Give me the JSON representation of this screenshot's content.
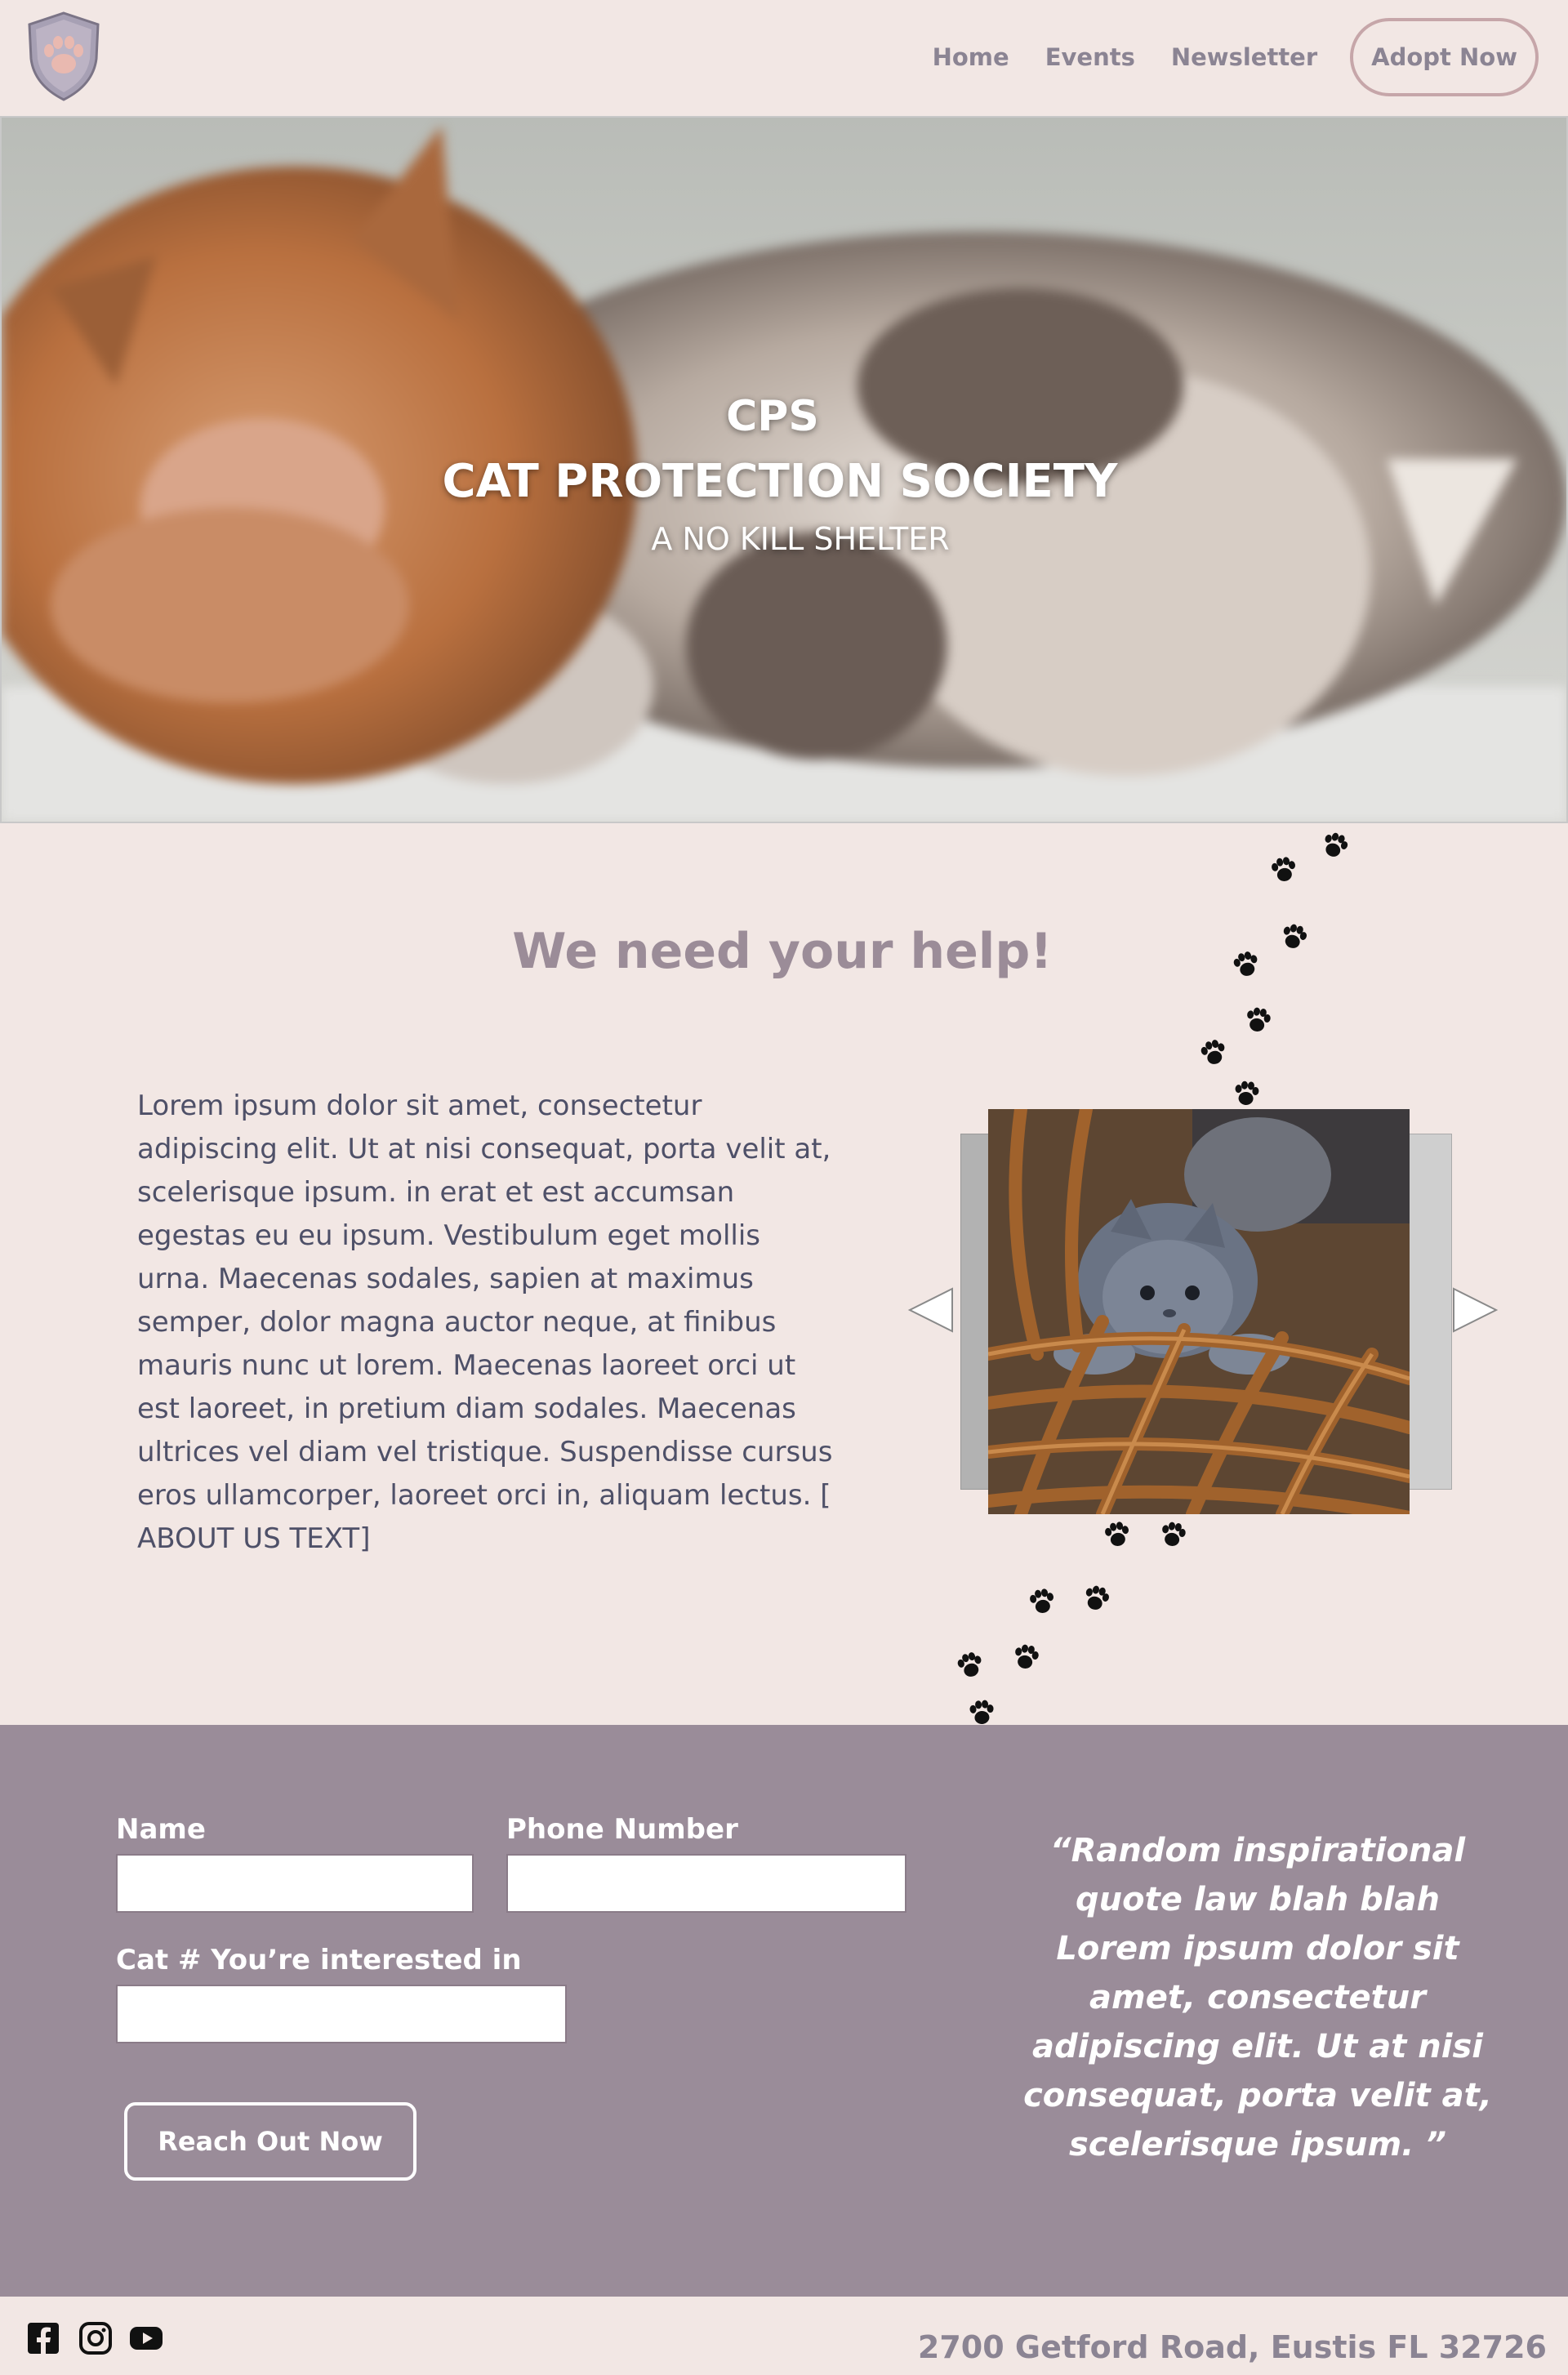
{
  "header": {
    "logo_alt": "paw shield logo",
    "nav": [
      {
        "label": "Home"
      },
      {
        "label": "Events"
      },
      {
        "label": "Newsletter"
      }
    ],
    "cta_label": "Adopt Now"
  },
  "hero": {
    "abbr": "CPS",
    "title": "CAT PROTECTION SOCIETY",
    "subtitle": "A NO KILL SHELTER"
  },
  "help": {
    "title": "We need your help!",
    "body": "Lorem ipsum dolor sit amet, consectetur adipiscing elit. Ut at nisi consequat, porta velit at, scelerisque ipsum. in erat et est accumsan egestas eu eu ipsum. Vestibulum eget mollis urna. Maecenas sodales, sapien at maximus semper, dolor magna auctor neque, at finibus mauris nunc ut lorem. Maecenas laoreet orci ut est laoreet, in pretium diam sodales. Maecenas ultrices vel diam vel tristique. Suspendisse cursus eros ullamcorper, laoreet orci in, aliquam lectus. [ ABOUT US TEXT]"
  },
  "form": {
    "name_label": "Name",
    "name_value": "",
    "phone_label": "Phone Number",
    "phone_value": "",
    "cat_label": "Cat # You’re interested in",
    "cat_value": "",
    "submit_label": "Reach Out Now"
  },
  "quote": "“Random inspirational quote law blah blah Lorem ipsum dolor sit amet, consectetur adipiscing elit. Ut at nisi consequat, porta velit at, scelerisque ipsum. ”",
  "footer": {
    "social": [
      "facebook-icon",
      "instagram-icon",
      "youtube-icon"
    ],
    "address": "2700 Getford Road, Eustis FL 32726"
  },
  "colors": {
    "background": "#f2e7e4",
    "mauve": "#9a8c99",
    "nav_text": "#8b8493",
    "button_border": "#c6a6a9"
  }
}
